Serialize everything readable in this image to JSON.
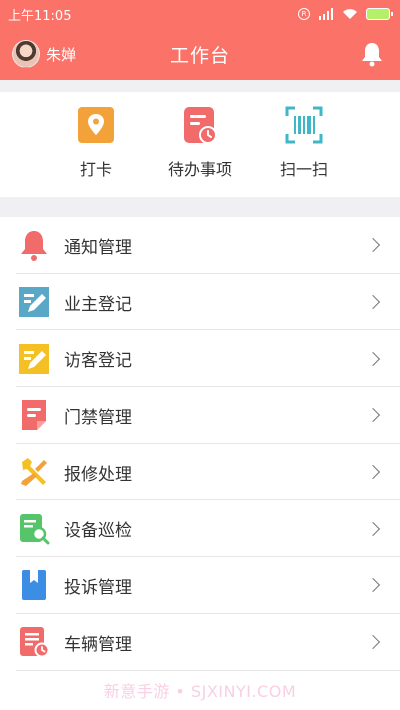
{
  "status_bar": {
    "time": "上午11:05",
    "icons": [
      "record-icon",
      "signal-icon",
      "wifi-icon",
      "battery-charging-icon"
    ]
  },
  "header": {
    "user_name": "朱婵",
    "title": "工作台",
    "right_icon": "bell-icon"
  },
  "colors": {
    "brand": "#fa7268",
    "background_gray": "#f0f0f3"
  },
  "quick_actions": [
    {
      "label": "打卡",
      "icon": "location-pin-icon",
      "color": "#f3a23a"
    },
    {
      "label": "待办事项",
      "icon": "todo-clock-icon",
      "color": "#f26b6b"
    },
    {
      "label": "扫一扫",
      "icon": "barcode-scan-icon",
      "color": "#3fb7c7"
    }
  ],
  "menu": [
    {
      "label": "通知管理",
      "icon": "bell-icon",
      "color": "#f26b6b"
    },
    {
      "label": "业主登记",
      "icon": "edit-form-icon",
      "color": "#5aa8c8"
    },
    {
      "label": "访客登记",
      "icon": "edit-form-icon",
      "color": "#f5c024"
    },
    {
      "label": "门禁管理",
      "icon": "document-icon",
      "color": "#f26b6b"
    },
    {
      "label": "报修处理",
      "icon": "wrench-icon",
      "color": "#f5c024"
    },
    {
      "label": "设备巡检",
      "icon": "inspect-search-icon",
      "color": "#56c46a"
    },
    {
      "label": "投诉管理",
      "icon": "bookmark-book-icon",
      "color": "#3c8ee4"
    },
    {
      "label": "车辆管理",
      "icon": "list-clock-icon",
      "color": "#f26b6b"
    }
  ],
  "watermark": "新意手游 • SJXINYI.COM"
}
